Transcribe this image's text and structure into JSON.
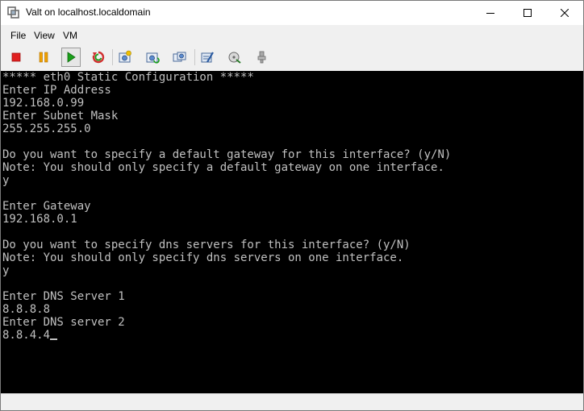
{
  "window": {
    "title": "Valt on localhost.localdomain"
  },
  "menu": {
    "items": [
      {
        "label": "File"
      },
      {
        "label": "View"
      },
      {
        "label": "VM"
      }
    ]
  },
  "toolbar": {
    "buttons": [
      {
        "icon": "stop-icon",
        "color": "#e02020"
      },
      {
        "icon": "pause-icon",
        "color": "#f0a000"
      },
      {
        "icon": "play-icon",
        "color": "#1aa01a",
        "pressed": true
      },
      {
        "icon": "reset-icon",
        "color": "#d03030"
      },
      {
        "icon": "snapshot-icon"
      },
      {
        "icon": "revert-snapshot-icon"
      },
      {
        "icon": "snapshot-manager-icon"
      },
      {
        "icon": "edit-settings-icon"
      },
      {
        "icon": "connect-device-icon"
      },
      {
        "icon": "disconnect-device-icon"
      }
    ]
  },
  "console": {
    "lines": [
      "***** eth0 Static Configuration *****",
      "Enter IP Address",
      "192.168.0.99",
      "Enter Subnet Mask",
      "255.255.255.0",
      "",
      "Do you want to specify a default gateway for this interface? (y/N)",
      "Note: You should only specify a default gateway on one interface.",
      "y",
      "",
      "Enter Gateway",
      "192.168.0.1",
      "",
      "Do you want to specify dns servers for this interface? (y/N)",
      "Note: You should only specify dns servers on one interface.",
      "y",
      "",
      "Enter DNS Server 1",
      "8.8.8.8",
      "Enter DNS server 2",
      "8.8.4.4"
    ]
  }
}
